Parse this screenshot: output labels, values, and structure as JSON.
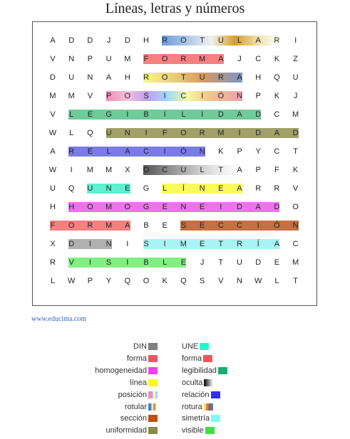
{
  "title": "Líneas,  letras  y números",
  "grid": [
    "ADDJDHROTULARI",
    "VNPUMFORMAJCKZ",
    "DUNAHROTURAHQU",
    "MMVPOSICIÓNPKJ",
    "VLEGIBILIDADCM",
    "WLQUNIFORMIDAD",
    "ARELACIÓNKPYCT",
    "WIMMXOCULTAPFK",
    "UQUNEGLÍNEARRV",
    "HHOMOGENEIDADO",
    "FORMABESECCIÓN",
    "XDINISIMETRÍAC",
    "RVISIBLEJTUDEM",
    "LWPYQOKQSVNWLT"
  ],
  "highlights": [
    {
      "name": "rotular",
      "row": 0,
      "start": 6,
      "end": 12,
      "gradient": "linear-gradient(90deg,#6a9bd8 0%,#a8c4e6 20%,#f0f0f0 42%,#d4a02a 62%,#f0e0b0 82%,#ffffff 100%)"
    },
    {
      "name": "forma-1",
      "row": 1,
      "start": 5,
      "end": 9,
      "color": "#f48080"
    },
    {
      "name": "rotura",
      "row": 2,
      "start": 5,
      "end": 10,
      "gradient": "linear-gradient(90deg,#f7f78a 0%,#e8c870 35%,#d49a60 60%,#7e96c6 100%)"
    },
    {
      "name": "posicion",
      "row": 3,
      "start": 3,
      "end": 10,
      "gradient": "linear-gradient(90deg,#f08ab8 0%,#f7c0d8 15%,#c0a0f0 30%,#a0d8f8 45%,#f8f8a0 60%,#f0c888 75%,#f0a0b0 100%)"
    },
    {
      "name": "legibilidad",
      "row": 4,
      "start": 1,
      "end": 11,
      "color": "#6fcb9a"
    },
    {
      "name": "uniformidad",
      "row": 5,
      "start": 3,
      "end": 13,
      "color": "#a0a068"
    },
    {
      "name": "relacion",
      "row": 6,
      "start": 1,
      "end": 8,
      "color": "#7b7be8"
    },
    {
      "name": "oculta",
      "row": 7,
      "start": 5,
      "end": 10,
      "gradient": "linear-gradient(90deg,#555555 0%,#8c8c8c 25%,#c8c8c8 55%,#f0f0f0 80%,#ffffff 100%)"
    },
    {
      "name": "une",
      "row": 8,
      "start": 2,
      "end": 4,
      "color": "#5ef0d0"
    },
    {
      "name": "linea",
      "row": 8,
      "start": 6,
      "end": 10,
      "color": "#fafa5a"
    },
    {
      "name": "homogeneidad",
      "row": 9,
      "start": 1,
      "end": 12,
      "color": "#f070f0"
    },
    {
      "name": "forma-2",
      "row": 10,
      "start": 0,
      "end": 4,
      "color": "#f48080"
    },
    {
      "name": "seccion",
      "row": 10,
      "start": 7,
      "end": 13,
      "color": "#c47042"
    },
    {
      "name": "din",
      "row": 11,
      "start": 1,
      "end": 3,
      "color": "#b0b0b0"
    },
    {
      "name": "simetria",
      "row": 11,
      "start": 5,
      "end": 12,
      "color": "#a8f4f4"
    },
    {
      "name": "visible",
      "row": 12,
      "start": 1,
      "end": 7,
      "color": "#80f080"
    }
  ],
  "url": "www.educima.com",
  "legend_left": [
    {
      "label": "DIN",
      "color": "#808080"
    },
    {
      "label": "forma",
      "color": "#f05858"
    },
    {
      "label": "homogeneidad",
      "color": "#f040f0"
    },
    {
      "label": "línea",
      "color": "#f8f820"
    },
    {
      "label": "posición",
      "gradient": "linear-gradient(90deg,#f08ab8 0%,#f08ab8 25%,#c0a0f0 25%,#c0a0f0 50%,#f8f8a0 50%,#f8f8a0 75%,#a0d8f8 75%)"
    },
    {
      "label": "rotular",
      "gradient": "linear-gradient(90deg,#4a7ec8 0%,#4a7ec8 33%,#ffffff 33%,#ffffff 50%,#d4a02a 50%,#d4a02a 80%,#ffffff 80%)"
    },
    {
      "label": "sección",
      "color": "#c05010"
    },
    {
      "label": "uniformidad",
      "color": "#8a8a4a"
    }
  ],
  "legend_right": [
    {
      "label": "UNE",
      "color": "#30f0c8"
    },
    {
      "label": "forma",
      "color": "#f05858"
    },
    {
      "label": "legibilidad",
      "color": "#20a870"
    },
    {
      "label": "oculta",
      "gradient": "linear-gradient(90deg,#000000 0%,#808080 50%,#ffffff 100%)"
    },
    {
      "label": "relación",
      "color": "#3030f0"
    },
    {
      "label": "rotura",
      "gradient": "linear-gradient(90deg,#f8e060 0%,#f8e060 25%,#d48050 25%,#d48050 50%,#8f6040 50%,#8f6040 75%,#5878c0 75%)"
    },
    {
      "label": "simetría",
      "color": "#80f8f8"
    },
    {
      "label": "visible",
      "color": "#40e040"
    }
  ]
}
